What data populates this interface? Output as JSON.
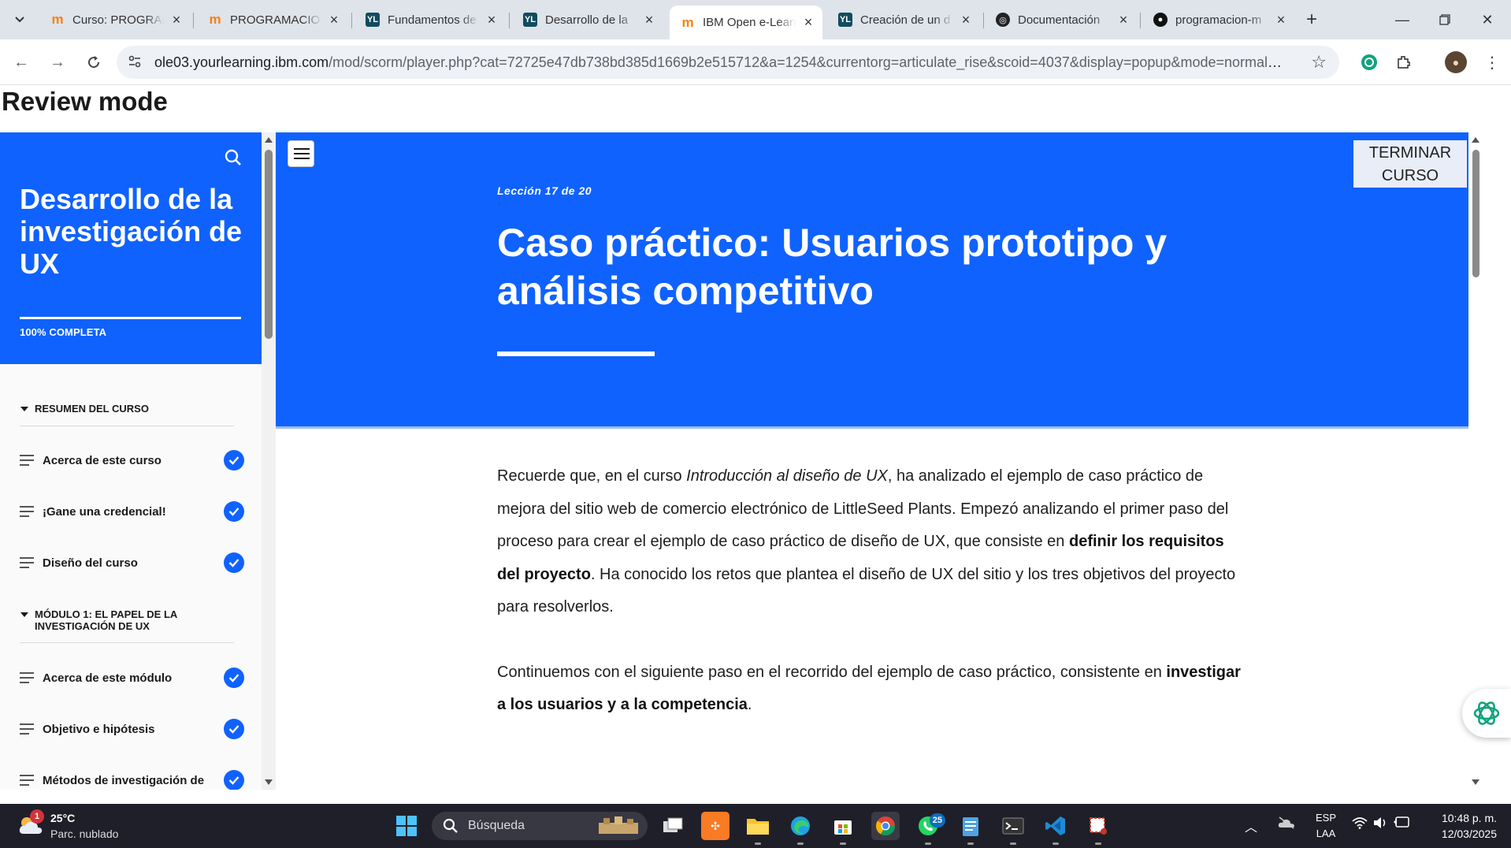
{
  "browser": {
    "tabs": [
      {
        "label": "Curso: PROGRAMACION",
        "favicon": "moodle-icon",
        "active": false
      },
      {
        "label": "PROGRAMACION",
        "favicon": "moodle-icon",
        "active": false
      },
      {
        "label": "Fundamentos de",
        "favicon": "yourlearning-icon",
        "active": false
      },
      {
        "label": "Desarrollo de la",
        "favicon": "yourlearning-icon",
        "active": false
      },
      {
        "label": "IBM Open e-Learning",
        "favicon": "moodle-icon",
        "active": true
      },
      {
        "label": "Creación de un d",
        "favicon": "yourlearning-icon",
        "active": false
      },
      {
        "label": "Documentación",
        "favicon": "openai-icon",
        "active": false
      },
      {
        "label": "programacion-m",
        "favicon": "github-icon",
        "active": false
      }
    ],
    "url_host": "ole03.yourlearning.ibm.com",
    "url_path": "/mod/scorm/player.php?cat=72725e47db738bd385d1669b2e515712&a=1254&currentorg=articulate_rise&scoid=4037&display=popup&mode=normal&lan..."
  },
  "page": {
    "review_title": "Review mode"
  },
  "sidebar": {
    "course_title": "Desarrollo de la investigación de UX",
    "progress_label": "100% COMPLETA",
    "progress_fraction": 1.0,
    "sections": [
      {
        "label": "RESUMEN DEL CURSO"
      },
      {
        "label": "MÓDULO 1: EL PAPEL DE LA INVESTIGACIÓN DE UX"
      }
    ],
    "items": [
      {
        "label": "Acerca de este curso",
        "completed": true
      },
      {
        "label": "¡Gane una credencial!",
        "completed": true
      },
      {
        "label": "Diseño del curso",
        "completed": true
      },
      {
        "label": "Acerca de este módulo",
        "completed": true
      },
      {
        "label": "Objetivo e hipótesis",
        "completed": true
      },
      {
        "label": "Métodos de investigación de",
        "completed": true
      }
    ]
  },
  "lesson": {
    "count": "Lección 17 de 20",
    "title": "Caso práctico: Usuarios prototipo y análisis competitivo",
    "finish_button": "TERMINAR CURSO",
    "p1_a": "Recuerde que, en el curso ",
    "p1_course": "Introducción al diseño de UX",
    "p1_b": ", ha analizado el ejemplo de caso práctico de mejora del sitio web de comercio electrónico de LittleSeed Plants. Empezó analizando el primer paso del proceso para crear el ejemplo de caso práctico de diseño de UX, que consiste en ",
    "p1_bold": "definir los requisitos del proyecto",
    "p1_c": ". Ha conocido los retos que plantea el diseño de UX del sitio y los tres objetivos del proyecto para resolverlos.",
    "p2_a": "Continuemos con el siguiente paso en el recorrido del ejemplo de caso práctico, consistente en ",
    "p2_bold": "investigar a los usuarios y a la competencia",
    "p2_c": "."
  },
  "taskbar": {
    "weather_temp": "25°C",
    "weather_condition": "Parc. nublado",
    "weather_badge": "1",
    "search_placeholder": "Búsqueda",
    "whatsapp_badge": "25",
    "lang_1": "ESP",
    "lang_2": "LAA",
    "time": "10:48 p. m.",
    "date": "12/03/2025"
  },
  "colors": {
    "accent": "#0f62fe",
    "tabstrip": "#dfe3ea",
    "taskbar": "#1f1f29"
  }
}
